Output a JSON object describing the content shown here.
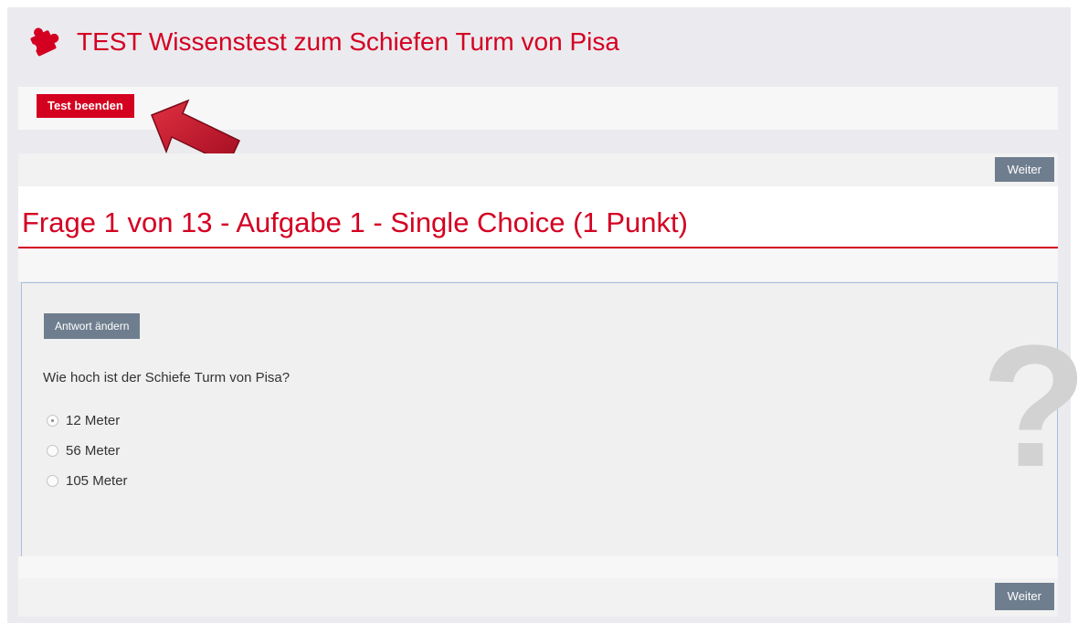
{
  "header": {
    "title": "TEST Wissenstest zum Schiefen Turm von Pisa",
    "icon": "puzzle-icon"
  },
  "actions": {
    "end_test": "Test beenden"
  },
  "nav": {
    "next_top": "Weiter",
    "next_bottom": "Weiter"
  },
  "question": {
    "heading": "Frage 1 von 13 - Aufgabe 1 - Single Choice (1 Punkt)",
    "change_answer": "Antwort ändern",
    "text": "Wie hoch ist der Schiefe Turm von Pisa?",
    "options": [
      {
        "label": "12 Meter",
        "selected": true
      },
      {
        "label": "56 Meter",
        "selected": false
      },
      {
        "label": "105 Meter",
        "selected": false
      }
    ],
    "watermark": "?"
  },
  "colors": {
    "accent": "#d40022",
    "button_grey": "#6f7e8e",
    "arrow": "#c8102e"
  }
}
